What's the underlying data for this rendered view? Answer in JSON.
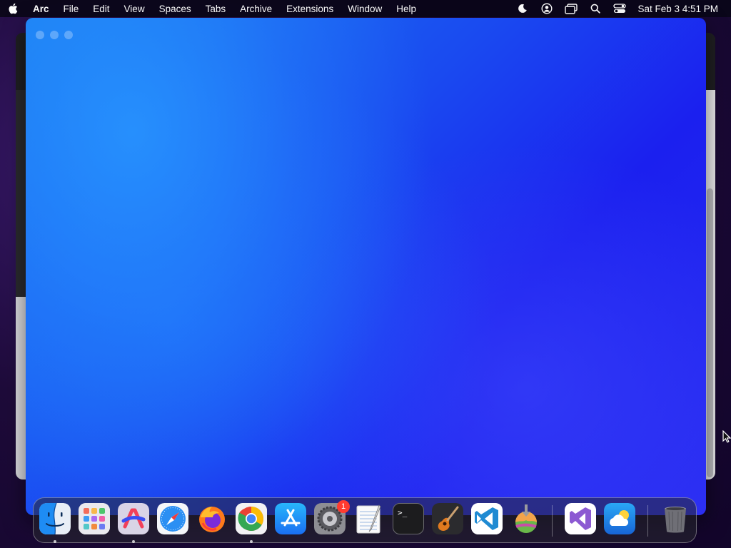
{
  "menubar": {
    "app_name": "Arc",
    "items": [
      "File",
      "Edit",
      "View",
      "Spaces",
      "Tabs",
      "Archive",
      "Extensions",
      "Window",
      "Help"
    ],
    "clock": "Sat Feb 3  4:51 PM",
    "status_icons": [
      "moon-icon",
      "user-circle-icon",
      "screen-mirroring-icon",
      "spotlight-search-icon",
      "control-center-icon"
    ]
  },
  "window": {
    "app": "Arc",
    "gradient_colors": [
      "#1a7ff0",
      "#1a4af0",
      "#1b20ef",
      "#2a2cf2"
    ]
  },
  "dock": {
    "apps": [
      {
        "id": "finder",
        "icon": "finder-icon",
        "running": true
      },
      {
        "id": "launchpad",
        "icon": "launchpad-icon",
        "running": false
      },
      {
        "id": "arc",
        "icon": "arc-browser-icon",
        "running": true
      },
      {
        "id": "safari",
        "icon": "safari-icon",
        "running": false
      },
      {
        "id": "firefox",
        "icon": "firefox-icon",
        "running": false
      },
      {
        "id": "chrome",
        "icon": "chrome-icon",
        "running": true
      },
      {
        "id": "app-store",
        "icon": "app-store-icon",
        "running": false
      },
      {
        "id": "system-settings",
        "icon": "system-settings-icon",
        "running": false,
        "badge": "1"
      },
      {
        "id": "textedit",
        "icon": "textedit-icon",
        "running": false
      },
      {
        "id": "terminal",
        "icon": "terminal-icon",
        "running": false
      },
      {
        "id": "garageband",
        "icon": "garageband-icon",
        "running": false
      },
      {
        "id": "vscode",
        "icon": "vscode-icon",
        "running": false
      },
      {
        "id": "macos-sonoma-installer",
        "icon": "installer-icon",
        "running": false
      }
    ],
    "recent": [
      {
        "id": "visual-studio",
        "icon": "visual-studio-icon"
      },
      {
        "id": "icloud-weather",
        "icon": "weather-cloud-icon"
      }
    ],
    "trash": {
      "icon": "trash-icon"
    },
    "settings_badge": "1",
    "terminal_glyph": ">_"
  }
}
